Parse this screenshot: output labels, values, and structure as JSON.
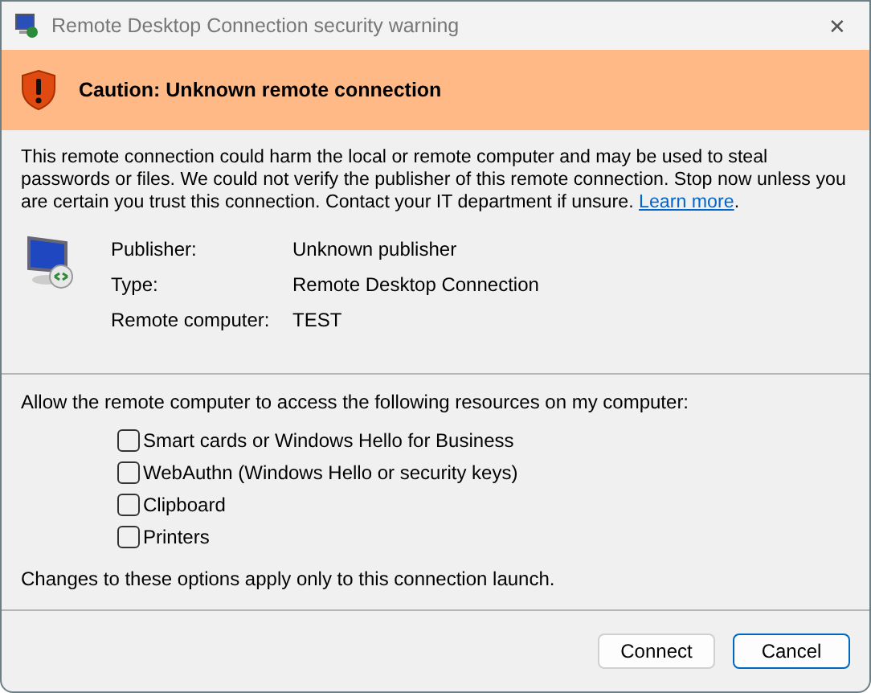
{
  "window": {
    "title": "Remote Desktop Connection security warning",
    "close": "✕"
  },
  "banner": {
    "title": "Caution: Unknown remote connection"
  },
  "message": {
    "text": "This remote connection could harm the local or remote computer and may be used to steal passwords or files. We could not verify the publisher of this remote connection. Stop now unless you are certain you trust this connection. Contact your IT department if unsure.",
    "link": "Learn more",
    "suffix": "."
  },
  "details": [
    {
      "label": "Publisher:",
      "value": "Unknown publisher"
    },
    {
      "label": "Type:",
      "value": "Remote Desktop Connection"
    },
    {
      "label": "Remote computer:",
      "value": "TEST"
    }
  ],
  "resources": {
    "heading": "Allow the remote computer to access the following resources on my computer:",
    "options": [
      {
        "label": "Smart cards or Windows Hello for Business",
        "checked": false
      },
      {
        "label": "WebAuthn (Windows Hello or security keys)",
        "checked": false
      },
      {
        "label": "Clipboard",
        "checked": false
      },
      {
        "label": "Printers",
        "checked": false
      }
    ],
    "note": "Changes to these options apply only to this connection launch."
  },
  "buttons": [
    {
      "label": "Connect",
      "default": false
    },
    {
      "label": "Cancel",
      "default": true
    }
  ]
}
